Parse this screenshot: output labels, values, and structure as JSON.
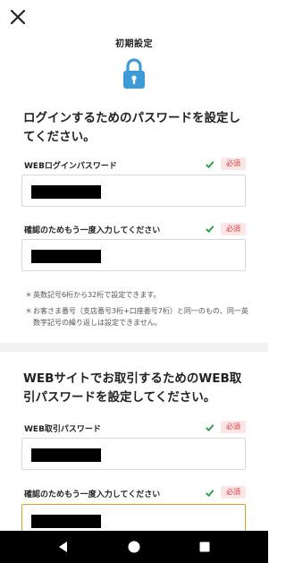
{
  "header": {
    "title": "初期設定",
    "close_icon": "close-icon",
    "lock_icon": "lock-icon"
  },
  "section1": {
    "heading": "ログインするためのパスワードを設定してください。",
    "field1": {
      "label": "WEBログインパスワード",
      "required": "必須",
      "status_icon": "check-icon"
    },
    "field2": {
      "label": "確認のためもう一度入力してください",
      "required": "必須",
      "status_icon": "check-icon"
    },
    "notes": [
      "英数記号6桁から32桁で設定できます。",
      "お客さま番号（支店番号3桁+口座番号7桁）と同一のもの、同一英数字記号の繰り返しは設定できません。"
    ],
    "note_bullet": "＊"
  },
  "section2": {
    "heading": "WEBサイトでお取引するためのWEB取引パスワードを設定してください。",
    "field1": {
      "label": "WEB取引パスワード",
      "required": "必須",
      "status_icon": "check-icon"
    },
    "field2": {
      "label": "確認のためもう一度入力してください",
      "required": "必須",
      "status_icon": "check-icon"
    }
  },
  "navbar": {
    "icons": [
      "back-icon",
      "home-icon",
      "recents-icon"
    ]
  },
  "colors": {
    "check": "#1f9d3a",
    "required_text": "#d93a3a",
    "required_bg": "#fde6e6",
    "lock": "#3e9bd8",
    "focus_border": "#d9a520"
  }
}
